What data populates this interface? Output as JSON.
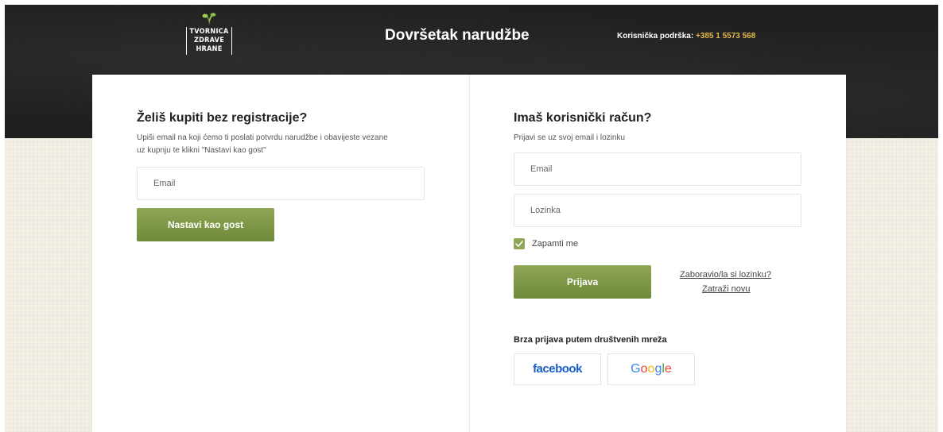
{
  "header": {
    "logo_text": [
      "TVORNICA",
      "ZDRAVE",
      "HRANE"
    ],
    "title": "Dovršetak narudžbe",
    "support_label": "Korisnička podrška:",
    "support_phone": "+385 1 5573 568"
  },
  "guest": {
    "heading": "Želiš kupiti bez registracije?",
    "description_line1": "Upiši email na koji ćemo ti poslati potvrdu narudžbe i obavijeste vezane",
    "description_line2": "uz kupnju te klikni \"Nastavi kao gost\"",
    "email_placeholder": "Email",
    "continue_label": "Nastavi kao gost"
  },
  "login": {
    "heading": "Imaš korisnički račun?",
    "description": "Prijavi se uz svoj email i lozinku",
    "email_placeholder": "Email",
    "password_placeholder": "Lozinka",
    "remember_label": "Zapamti me",
    "remember_checked": true,
    "login_label": "Prijava",
    "forgot_label": "Zaboravio/la si lozinku?",
    "request_new_label": "Zatraži novu"
  },
  "social": {
    "heading": "Brza prijava putem društvenih mreža",
    "facebook_label": "facebook",
    "google_letters": [
      {
        "char": "G",
        "color": "#4285F4"
      },
      {
        "char": "o",
        "color": "#EA4335"
      },
      {
        "char": "o",
        "color": "#FBBC05"
      },
      {
        "char": "g",
        "color": "#4285F4"
      },
      {
        "char": "l",
        "color": "#34A853"
      },
      {
        "char": "e",
        "color": "#EA4335"
      }
    ]
  },
  "colors": {
    "accent_green": "#7d9646",
    "phone_gold": "#e7b84a",
    "facebook_blue": "#1a5dc9"
  }
}
